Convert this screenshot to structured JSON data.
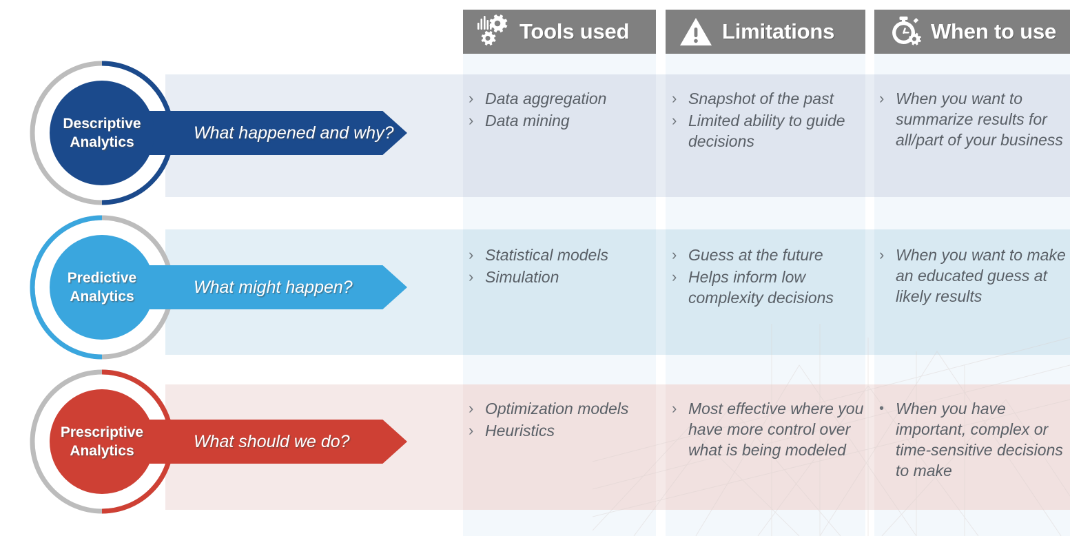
{
  "colors": {
    "descriptive": "#1b4a8c",
    "predictive": "#3aa6de",
    "prescriptive": "#ce4034",
    "ring_gray": "#bcbcbc",
    "header_gray": "#808080",
    "body_text": "#595f66"
  },
  "headers": [
    {
      "id": "tools-used",
      "label": "Tools used",
      "icon": "gears-icon"
    },
    {
      "id": "limitations",
      "label": "Limitations",
      "icon": "warning-triangle-icon"
    },
    {
      "id": "when-to-use",
      "label": "When to use",
      "icon": "stopwatch-gear-icon"
    }
  ],
  "rows": [
    {
      "id": "descriptive",
      "title_line1": "Descriptive",
      "title_line2": "Analytics",
      "question": "What happened and why?",
      "color": "#1b4a8c",
      "arc_side": "right",
      "tools": [
        {
          "mark": "›",
          "text": "Data aggregation"
        },
        {
          "mark": "›",
          "text": "Data mining"
        }
      ],
      "limitations": [
        {
          "mark": "›",
          "text": "Snapshot of the past"
        },
        {
          "mark": "›",
          "text": "Limited ability to guide decisions"
        }
      ],
      "when": [
        {
          "mark": "›",
          "text": "When you want to summarize results for all/part of your business"
        }
      ]
    },
    {
      "id": "predictive",
      "title_line1": "Predictive",
      "title_line2": "Analytics",
      "question": "What might happen?",
      "color": "#3aa6de",
      "arc_side": "left",
      "tools": [
        {
          "mark": "›",
          "text": "Statistical models"
        },
        {
          "mark": "›",
          "text": "Simulation"
        }
      ],
      "limitations": [
        {
          "mark": "›",
          "text": "Guess at the future"
        },
        {
          "mark": "›",
          "text": "Helps inform low complexity decisions"
        }
      ],
      "when": [
        {
          "mark": "›",
          "text": "When you want to make an educated guess at likely results"
        }
      ]
    },
    {
      "id": "prescriptive",
      "title_line1": "Prescriptive",
      "title_line2": "Analytics",
      "question": "What should we do?",
      "color": "#ce4034",
      "arc_side": "right",
      "tools": [
        {
          "mark": "›",
          "text": "Optimization models"
        },
        {
          "mark": "›",
          "text": "Heuristics"
        }
      ],
      "limitations": [
        {
          "mark": "›",
          "text": "Most effective where you have more control over what is being modeled"
        }
      ],
      "when": [
        {
          "mark": "•",
          "text": "When you have important, complex or time-sensitive decisions to make"
        }
      ]
    }
  ]
}
